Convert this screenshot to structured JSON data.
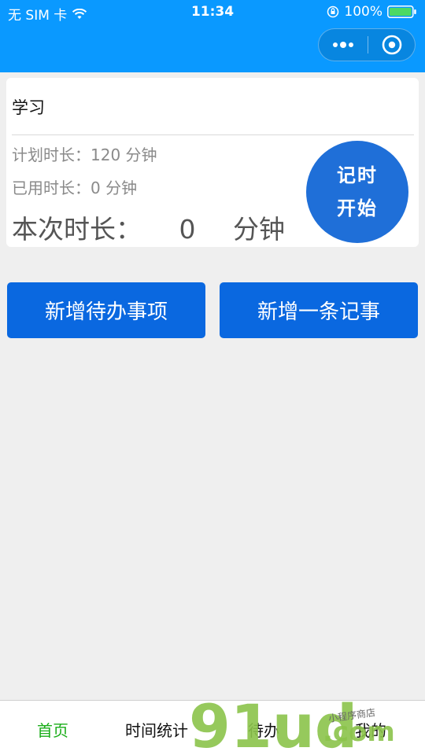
{
  "status_bar": {
    "carrier": "无 SIM 卡",
    "time": "11:34",
    "battery": "100%"
  },
  "capsule": {
    "more_icon": "more-dots-icon",
    "close_icon": "target-close-icon"
  },
  "card": {
    "title": "学习",
    "planned": "计划时长：120 分钟",
    "used": "已用时长：0 分钟",
    "session_label": "本次时长：",
    "session_value": "0",
    "session_unit": "分钟",
    "start_line1": "记时",
    "start_line2": "开始"
  },
  "actions": {
    "add_todo": "新增待办事项",
    "add_note": "新增一条记事"
  },
  "tabbar": {
    "home": "首页",
    "stats": "时间统计",
    "todo": "待办",
    "mine": "我的"
  },
  "watermark": {
    "brand": "91ud",
    "tld": ".com",
    "tagline": "小程序商店"
  },
  "colors": {
    "nav_bar": "#0a99ff",
    "primary_button": "#0a68e0",
    "start_circle": "#1f6fd8",
    "tab_active": "#1aad19",
    "watermark_green": "#8bc34a"
  }
}
